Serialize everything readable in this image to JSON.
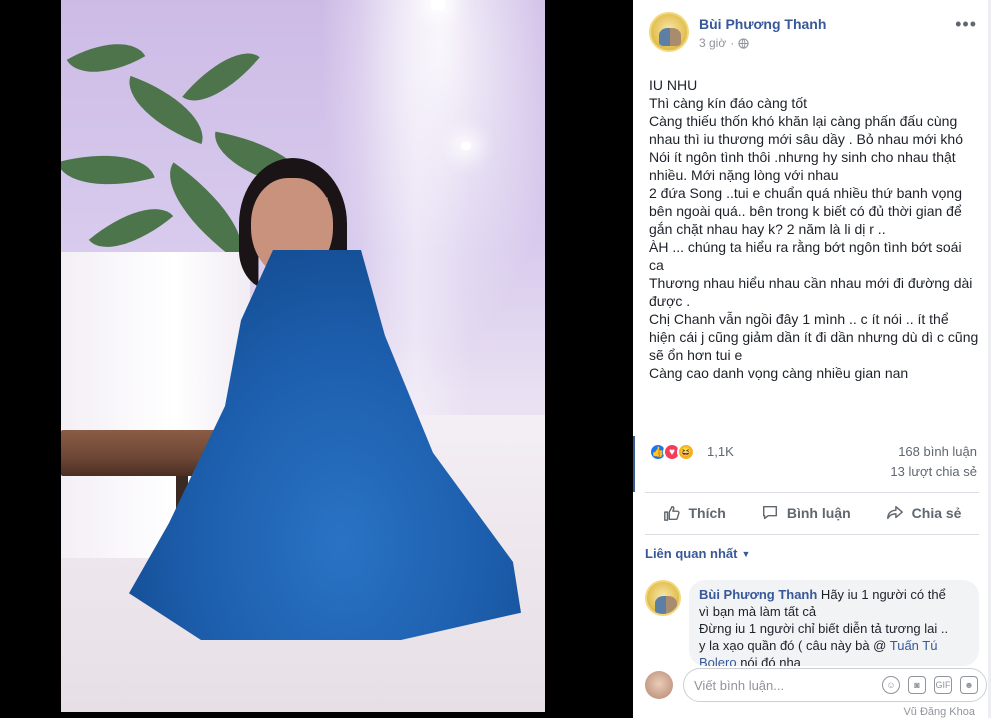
{
  "post": {
    "author": "Bùi Phương Thanh",
    "time": "3 giờ",
    "privacy_icon": "globe-icon",
    "more_label": "•••",
    "lines": [
      "IU NHU",
      "Thì càng kín đáo càng tốt",
      "Càng thiếu thốn khó khăn lại càng phấn đấu cùng",
      "nhau thì iu thương mới sâu dầy . Bỏ nhau mới khó",
      "Nói ít ngôn tình thôi .nhưng hy sinh cho nhau thật",
      "nhiều. Mới nặng lòng với nhau",
      "2 đứa Song ..tui e chuẩn quá nhiều thứ banh vọng",
      "bên ngoài quá.. bên trong k biết có đủ thời gian để",
      "gắn chặt nhau hay k? 2 năm là li dị r ..",
      "ÀH ... chúng ta hiểu ra rằng bớt ngôn tình bớt soái",
      "ca",
      "Thương nhau hiểu nhau cần nhau mới đi đường dài",
      "được .",
      "Chị Chanh vẫn ngồi đây 1 mình .. c ít nói .. ít thể",
      "hiện cái j cũng giảm dần ít đi dần nhưng dù dì c cũng",
      "sẽ ổn hơn tui e",
      "Càng cao danh vọng càng nhiều gian nan"
    ]
  },
  "reactions": {
    "types": [
      "like",
      "love",
      "haha"
    ],
    "count": "1,1K",
    "comments": "168 bình luận",
    "shares": "13 lượt chia sẻ"
  },
  "actions": {
    "like": "Thích",
    "comment": "Bình luận",
    "share": "Chia sẻ"
  },
  "sort": {
    "label": "Liên quan nhất"
  },
  "comment": {
    "author": "Bùi Phương Thanh",
    "text_1": " Hãy iu 1 người có thể",
    "text_2": "vì bạn mà làm tất cả",
    "text_3": "Đừng iu 1 người chỉ biết diễn tả tương lai ..",
    "text_4": "y la xạo quần đó ( câu này bà @ ",
    "mention": "Tuấn Tú Bolero",
    "text_5": " nói đó nha"
  },
  "composer": {
    "placeholder": "Viết bình luận...",
    "icons": [
      "emoji-icon",
      "camera-icon",
      "gif-icon",
      "sticker-icon"
    ]
  },
  "footer": {
    "peek": "Vũ Đăng Khoa"
  },
  "colors": {
    "link": "#385898",
    "like": "#1877f2",
    "love": "#f33e58",
    "haha": "#f7b125"
  }
}
